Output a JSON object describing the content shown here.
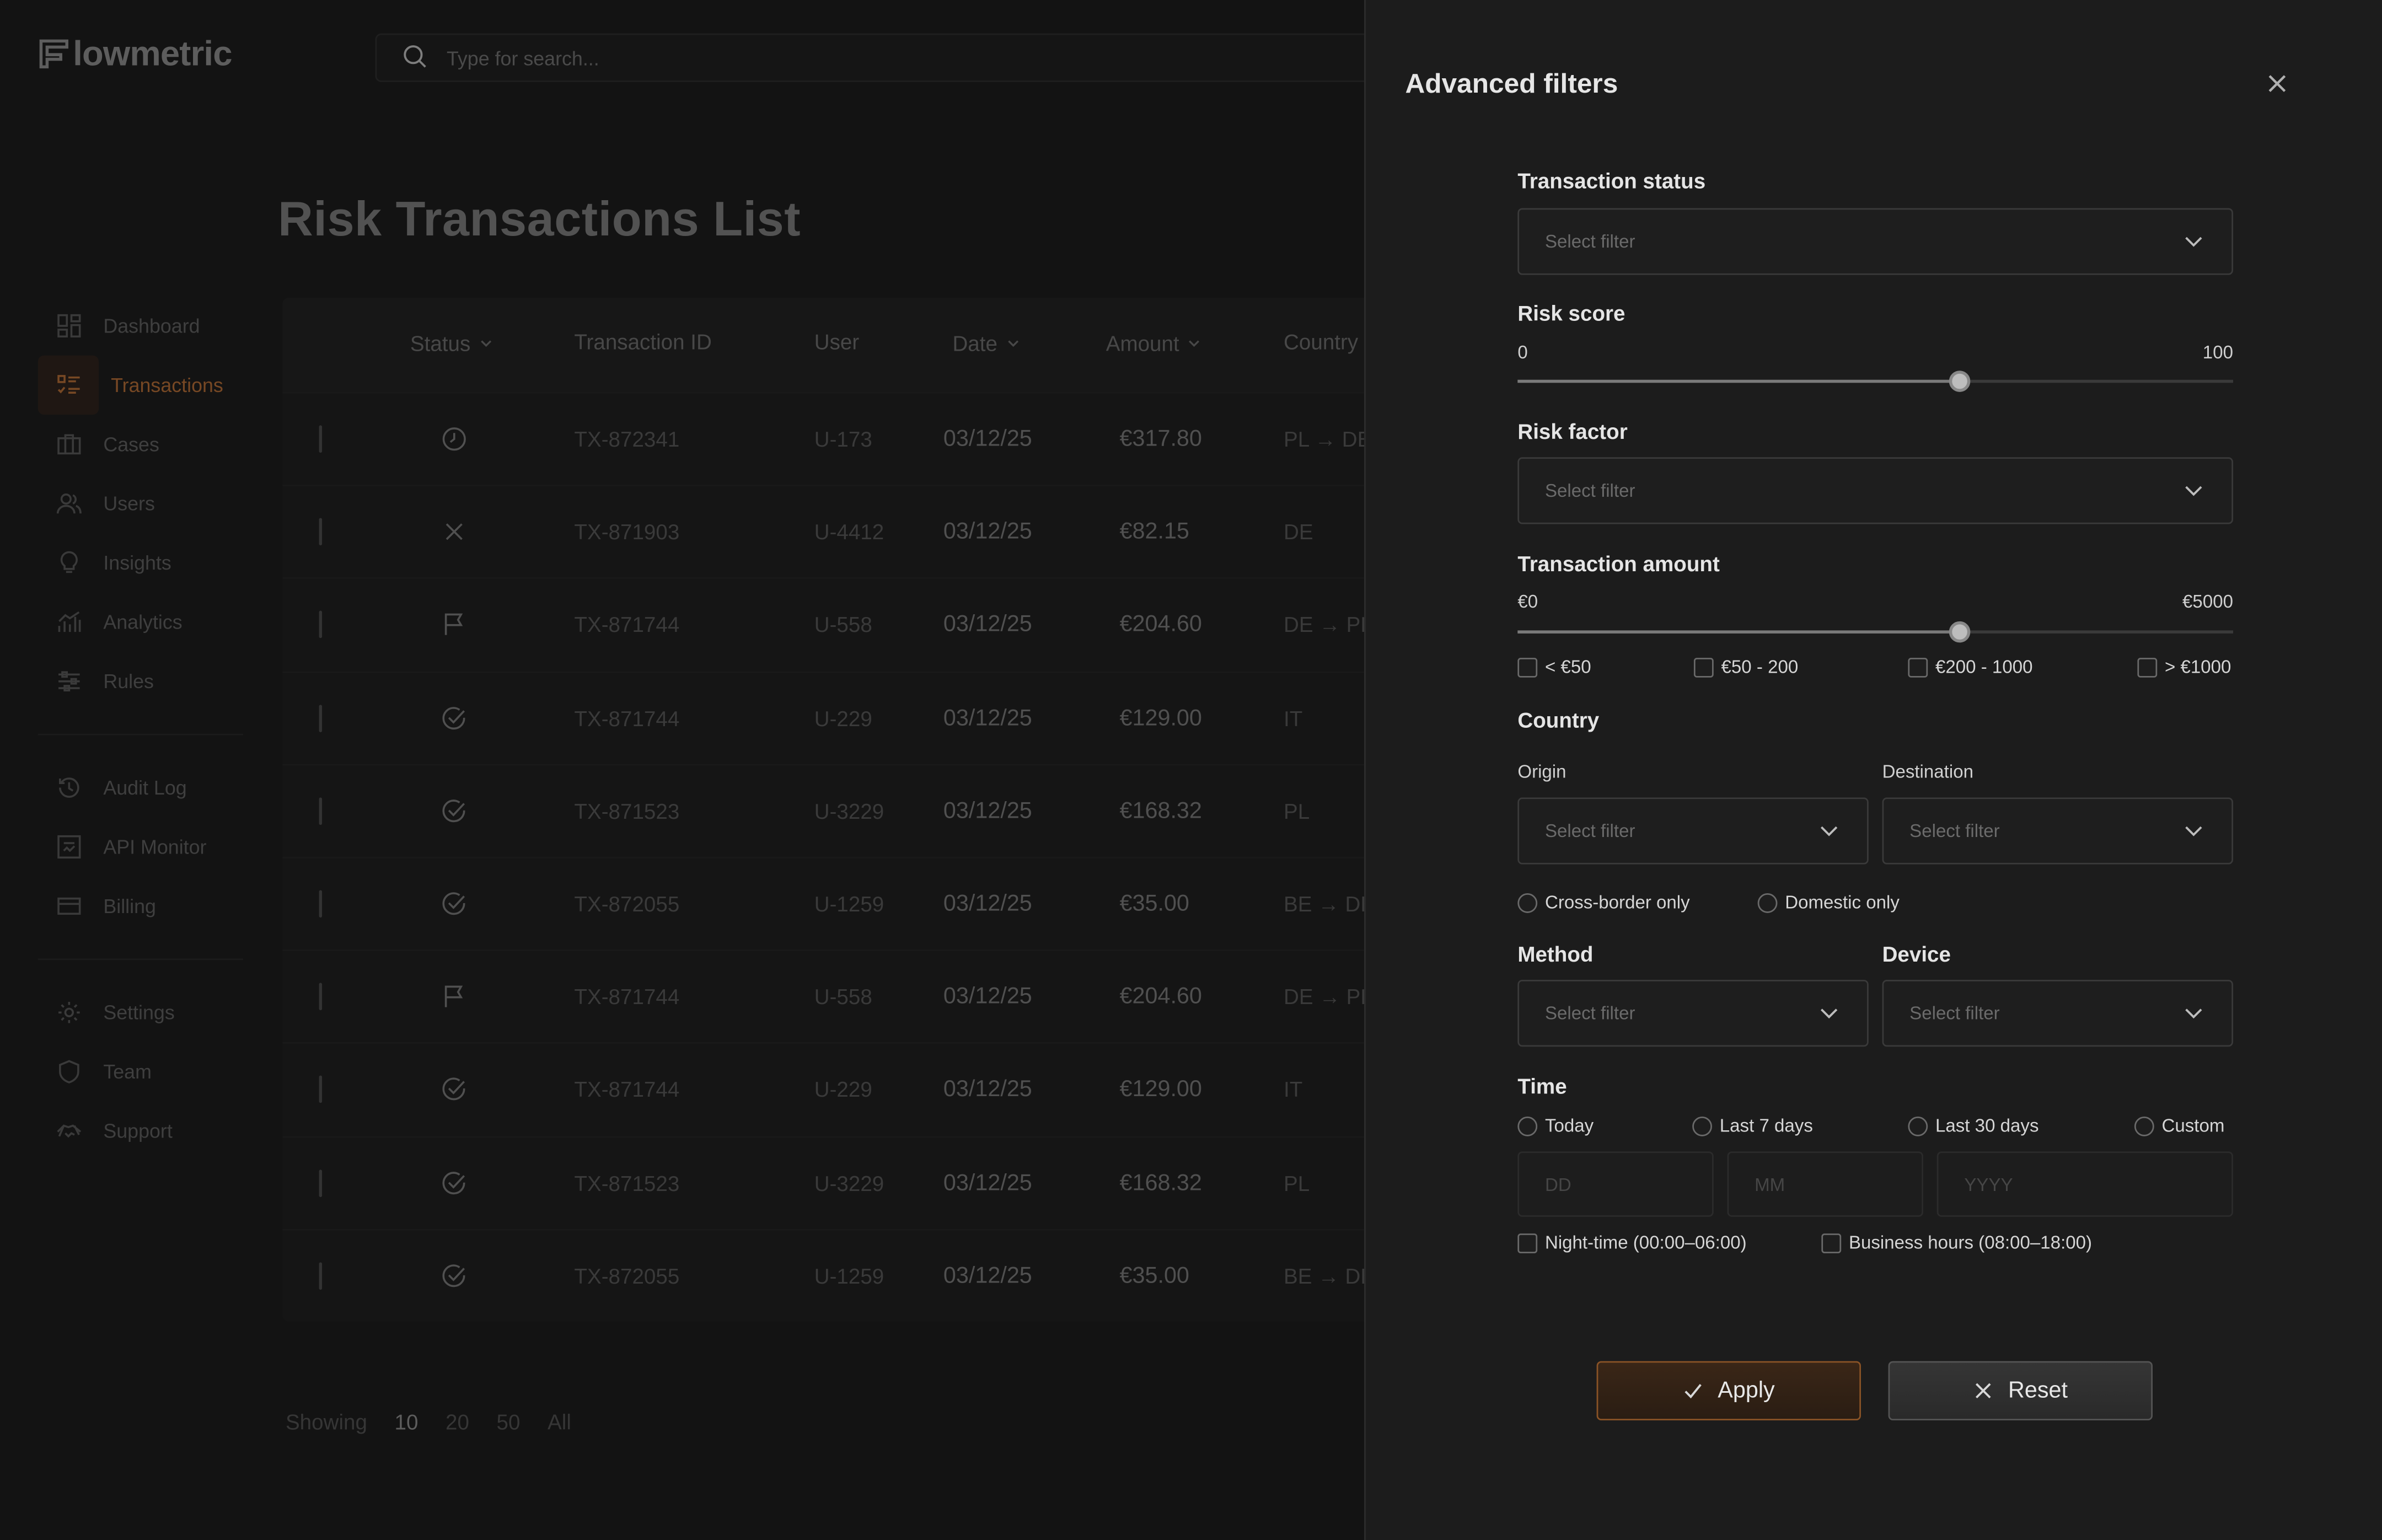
{
  "app": {
    "logo_text": "lowmetric"
  },
  "search": {
    "placeholder": "Type for search..."
  },
  "sidebar": {
    "items": [
      {
        "label": "Dashboard",
        "icon": "dashboard-icon"
      },
      {
        "label": "Transactions",
        "icon": "list-icon",
        "active": true
      },
      {
        "label": "Cases",
        "icon": "briefcase-icon"
      },
      {
        "label": "Users",
        "icon": "users-icon"
      },
      {
        "label": "Insights",
        "icon": "bulb-icon"
      },
      {
        "label": "Analytics",
        "icon": "bar-chart-icon"
      },
      {
        "label": "Rules",
        "icon": "sliders-icon"
      }
    ],
    "items2": [
      {
        "label": "Audit Log",
        "icon": "history-icon"
      },
      {
        "label": "API Monitor",
        "icon": "api-icon"
      },
      {
        "label": "Billing",
        "icon": "card-icon"
      }
    ],
    "items3": [
      {
        "label": "Settings",
        "icon": "gear-icon"
      },
      {
        "label": "Team",
        "icon": "shield-icon"
      },
      {
        "label": "Support",
        "icon": "handshake-icon"
      }
    ]
  },
  "page": {
    "title": "Risk Transactions List"
  },
  "table": {
    "headers": {
      "status": "Status",
      "txid": "Transaction ID",
      "user": "User",
      "date": "Date",
      "amount": "Amount",
      "country": "Country"
    },
    "rows": [
      {
        "status": "pending",
        "txid": "TX-872341",
        "user": "U-173",
        "date": "03/12/25",
        "amount": "€317.80",
        "country": "PL → DE"
      },
      {
        "status": "rejected",
        "txid": "TX-871903",
        "user": "U-4412",
        "date": "03/12/25",
        "amount": "€82.15",
        "country": "DE"
      },
      {
        "status": "flagged",
        "txid": "TX-871744",
        "user": "U-558",
        "date": "03/12/25",
        "amount": "€204.60",
        "country": "DE → PL"
      },
      {
        "status": "approved",
        "txid": "TX-871744",
        "user": "U-229",
        "date": "03/12/25",
        "amount": "€129.00",
        "country": "IT"
      },
      {
        "status": "approved",
        "txid": "TX-871523",
        "user": "U-3229",
        "date": "03/12/25",
        "amount": "€168.32",
        "country": "PL"
      },
      {
        "status": "approved",
        "txid": "TX-872055",
        "user": "U-1259",
        "date": "03/12/25",
        "amount": "€35.00",
        "country": "BE → DE"
      },
      {
        "status": "flagged",
        "txid": "TX-871744",
        "user": "U-558",
        "date": "03/12/25",
        "amount": "€204.60",
        "country": "DE → PL"
      },
      {
        "status": "approved",
        "txid": "TX-871744",
        "user": "U-229",
        "date": "03/12/25",
        "amount": "€129.00",
        "country": "IT"
      },
      {
        "status": "approved",
        "txid": "TX-871523",
        "user": "U-3229",
        "date": "03/12/25",
        "amount": "€168.32",
        "country": "PL"
      },
      {
        "status": "approved",
        "txid": "TX-872055",
        "user": "U-1259",
        "date": "03/12/25",
        "amount": "€35.00",
        "country": "BE → DE"
      }
    ]
  },
  "pager": {
    "label": "Showing",
    "options": [
      "10",
      "20",
      "50",
      "All"
    ],
    "selected": "10"
  },
  "panel": {
    "title": "Advanced filters",
    "status": {
      "label": "Transaction status",
      "placeholder": "Select filter"
    },
    "risk_score": {
      "label": "Risk score",
      "min": "0",
      "max": "100",
      "value_fraction": 0.617
    },
    "risk_factor": {
      "label": "Risk factor",
      "placeholder": "Select filter"
    },
    "amount": {
      "label": "Transaction amount",
      "min": "€0",
      "max": "€5000",
      "value_fraction": 0.617,
      "buckets": [
        "< €50",
        "€50 - 200",
        "€200 - 1000",
        "> €1000"
      ]
    },
    "country": {
      "label": "Country",
      "origin_label": "Origin",
      "origin_placeholder": "Select filter",
      "dest_label": "Destination",
      "dest_placeholder": "Select filter",
      "options": [
        "Cross-border only",
        "Domestic only"
      ]
    },
    "method": {
      "label": "Method",
      "placeholder": "Select filter"
    },
    "device": {
      "label": "Device",
      "placeholder": "Select filter"
    },
    "time": {
      "label": "Time",
      "options": [
        "Today",
        "Last 7 days",
        "Last 30 days",
        "Custom"
      ],
      "dd": "DD",
      "mm": "MM",
      "yyyy": "YYYY",
      "checks": [
        "Night-time (00:00–06:00)",
        "Business hours (08:00–18:00)"
      ]
    },
    "apply_label": "Apply",
    "reset_label": "Reset"
  },
  "colors": {
    "accent": "#b26a33",
    "background": "#1a1a1a",
    "panel": "#1c1c1c"
  }
}
